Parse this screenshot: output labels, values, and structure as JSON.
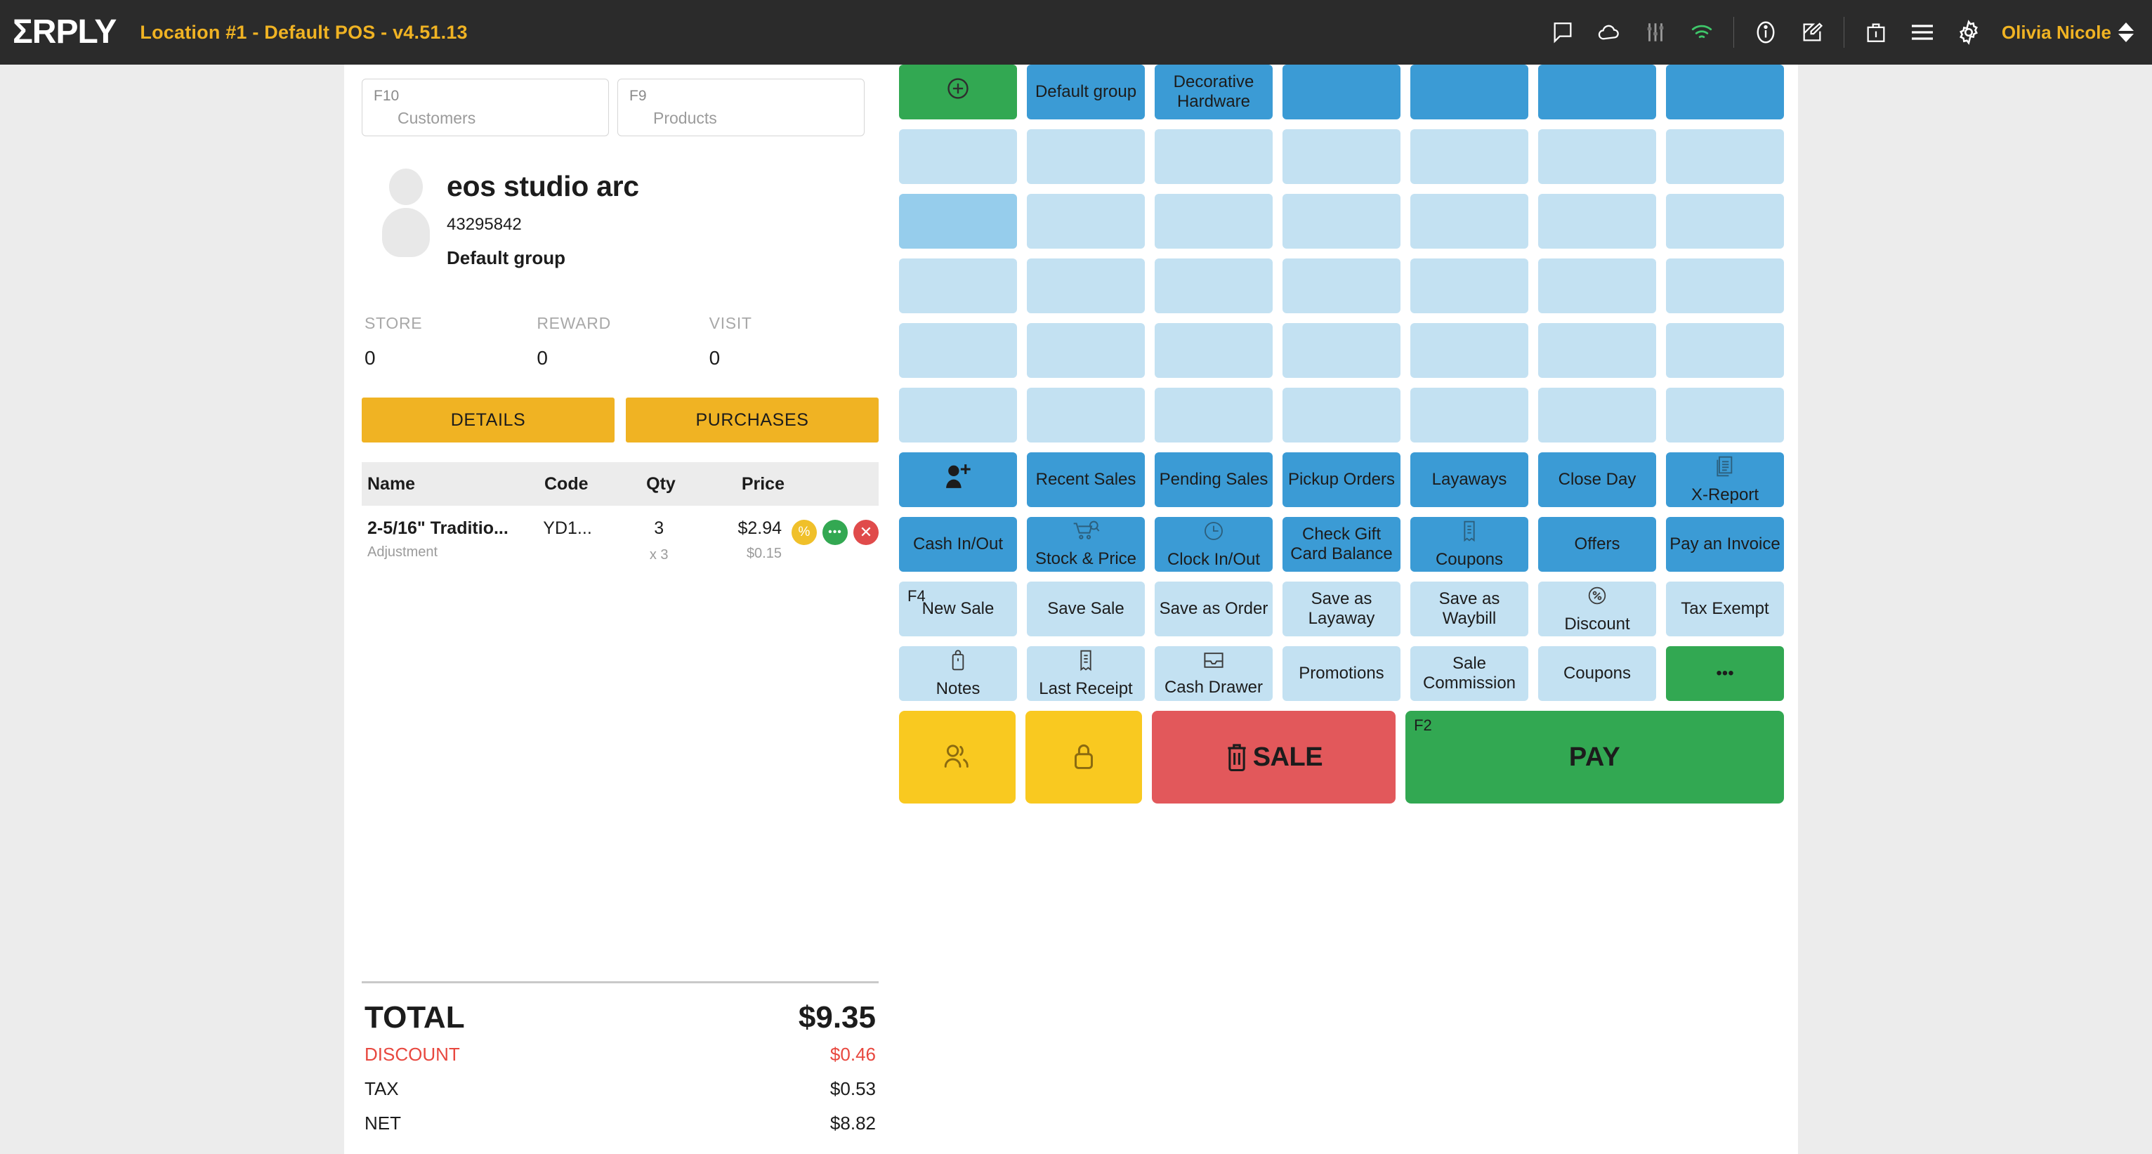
{
  "topbar": {
    "logo": "ΣRPLY",
    "location": "Location #1 - Default POS - v4.51.13",
    "user": "Olivia Nicole",
    "icons": [
      "chat-icon",
      "cloud-icon",
      "sliders-icon",
      "wifi-icon",
      "info-icon",
      "compose-icon",
      "briefcase-icon",
      "menu-icon",
      "gear-icon"
    ],
    "accent_yellow": "#f0b323",
    "wifi_color": "#3fc76a",
    "bg": "#2b2b2b"
  },
  "search": {
    "customers": {
      "key": "F10",
      "placeholder": "Customers"
    },
    "products": {
      "key": "F9",
      "placeholder": "Products"
    }
  },
  "customer": {
    "name": "eos studio arc",
    "id": "43295842",
    "group": "Default group",
    "stats": [
      {
        "label": "STORE",
        "value": "0"
      },
      {
        "label": "REWARD",
        "value": "0"
      },
      {
        "label": "VISIT",
        "value": "0"
      }
    ],
    "tabs": [
      {
        "label": "DETAILS"
      },
      {
        "label": "PURCHASES"
      }
    ]
  },
  "cart_table": {
    "headers": [
      "Name",
      "Code",
      "Qty",
      "Price",
      ""
    ],
    "rows": [
      {
        "name": "2-5/16\" Traditio...",
        "sub": "Adjustment",
        "code": "YD1...",
        "qty": "3",
        "qty_sub": "x 3",
        "price": "$2.94",
        "price_sub": "$0.15",
        "actions": [
          "%",
          "•••",
          "✕"
        ]
      }
    ]
  },
  "totals": {
    "total_label": "TOTAL",
    "total_value": "$9.35",
    "rows": [
      {
        "label": "DISCOUNT",
        "value": "$0.46",
        "color": "#e8483f"
      },
      {
        "label": "TAX",
        "value": "$0.53",
        "color": "#1c1c1c"
      },
      {
        "label": "NET",
        "value": "$8.82",
        "color": "#1c1c1c"
      }
    ]
  },
  "grid": {
    "product_rows": [
      [
        {
          "label": "",
          "style": "green",
          "icon": "plus-circle-icon"
        },
        {
          "label": "Default group",
          "style": "blue"
        },
        {
          "label": "Decorative Hardware",
          "style": "blue"
        },
        {
          "label": "",
          "style": "blue"
        },
        {
          "label": "",
          "style": "blue"
        },
        {
          "label": "",
          "style": "blue"
        },
        {
          "label": "",
          "style": "blue"
        }
      ],
      [
        {
          "label": "",
          "style": "lightblue"
        },
        {
          "label": "",
          "style": "lightblue"
        },
        {
          "label": "",
          "style": "lightblue"
        },
        {
          "label": "",
          "style": "lightblue"
        },
        {
          "label": "",
          "style": "lightblue"
        },
        {
          "label": "",
          "style": "lightblue"
        },
        {
          "label": "",
          "style": "lightblue"
        }
      ],
      [
        {
          "label": "",
          "style": "lightblue2"
        },
        {
          "label": "",
          "style": "lightblue"
        },
        {
          "label": "",
          "style": "lightblue"
        },
        {
          "label": "",
          "style": "lightblue"
        },
        {
          "label": "",
          "style": "lightblue"
        },
        {
          "label": "",
          "style": "lightblue"
        },
        {
          "label": "",
          "style": "lightblue"
        }
      ],
      [
        {
          "label": "",
          "style": "lightblue"
        },
        {
          "label": "",
          "style": "lightblue"
        },
        {
          "label": "",
          "style": "lightblue"
        },
        {
          "label": "",
          "style": "lightblue"
        },
        {
          "label": "",
          "style": "lightblue"
        },
        {
          "label": "",
          "style": "lightblue"
        },
        {
          "label": "",
          "style": "lightblue"
        }
      ],
      [
        {
          "label": "",
          "style": "lightblue"
        },
        {
          "label": "",
          "style": "lightblue"
        },
        {
          "label": "",
          "style": "lightblue"
        },
        {
          "label": "",
          "style": "lightblue"
        },
        {
          "label": "",
          "style": "lightblue"
        },
        {
          "label": "",
          "style": "lightblue"
        },
        {
          "label": "",
          "style": "lightblue"
        }
      ],
      [
        {
          "label": "",
          "style": "lightblue"
        },
        {
          "label": "",
          "style": "lightblue"
        },
        {
          "label": "",
          "style": "lightblue"
        },
        {
          "label": "",
          "style": "lightblue"
        },
        {
          "label": "",
          "style": "lightblue"
        },
        {
          "label": "",
          "style": "lightblue"
        },
        {
          "label": "",
          "style": "lightblue"
        }
      ]
    ],
    "function_rows": [
      [
        {
          "label": "",
          "style": "blue",
          "icon": "add-person-icon"
        },
        {
          "label": "Recent Sales",
          "style": "blue"
        },
        {
          "label": "Pending Sales",
          "style": "blue"
        },
        {
          "label": "Pickup Orders",
          "style": "blue"
        },
        {
          "label": "Layaways",
          "style": "blue"
        },
        {
          "label": "Close Day",
          "style": "blue"
        },
        {
          "label": "X-Report",
          "style": "blue",
          "icon": "documents-icon"
        }
      ],
      [
        {
          "label": "Cash In/Out",
          "style": "blue"
        },
        {
          "label": "Stock & Price",
          "style": "blue",
          "icon": "cart-search-icon"
        },
        {
          "label": "Clock In/Out",
          "style": "blue",
          "icon": "clock-icon"
        },
        {
          "label": "Check Gift Card Balance",
          "style": "blue"
        },
        {
          "label": "Coupons",
          "style": "blue",
          "icon": "receipt-icon"
        },
        {
          "label": "Offers",
          "style": "blue"
        },
        {
          "label": "Pay an Invoice",
          "style": "blue"
        }
      ],
      [
        {
          "label": "New Sale",
          "style": "lightblue",
          "fkey": "F4"
        },
        {
          "label": "Save Sale",
          "style": "lightblue"
        },
        {
          "label": "Save as Order",
          "style": "lightblue"
        },
        {
          "label": "Save as Layaway",
          "style": "lightblue"
        },
        {
          "label": "Save as Waybill",
          "style": "lightblue"
        },
        {
          "label": "Discount",
          "style": "lightblue",
          "icon": "percent-circle-icon"
        },
        {
          "label": "Tax Exempt",
          "style": "lightblue"
        }
      ],
      [
        {
          "label": "Notes",
          "style": "lightblue",
          "icon": "bag-icon"
        },
        {
          "label": "Last Receipt",
          "style": "lightblue",
          "icon": "receipt-icon"
        },
        {
          "label": "Cash Drawer",
          "style": "lightblue",
          "icon": "drawer-icon"
        },
        {
          "label": "Promotions",
          "style": "lightblue"
        },
        {
          "label": "Sale Commission",
          "style": "lightblue"
        },
        {
          "label": "Coupons",
          "style": "lightblue"
        },
        {
          "label": "•••",
          "style": "green"
        }
      ]
    ],
    "actions": {
      "users": {
        "icon": "users-icon",
        "style": "yellow"
      },
      "lock": {
        "icon": "lock-icon",
        "style": "yellow"
      },
      "sale": {
        "label": "SALE",
        "icon": "trash-icon",
        "style": "red"
      },
      "pay": {
        "label": "PAY",
        "fkey": "F2",
        "style": "green"
      }
    }
  },
  "colors": {
    "blue": "#3b9bd5",
    "lightblue": "#c3e1f2",
    "green": "#32a852",
    "yellow": "#f9c920",
    "red": "#e2585b",
    "dark": "#2b2b2b"
  }
}
